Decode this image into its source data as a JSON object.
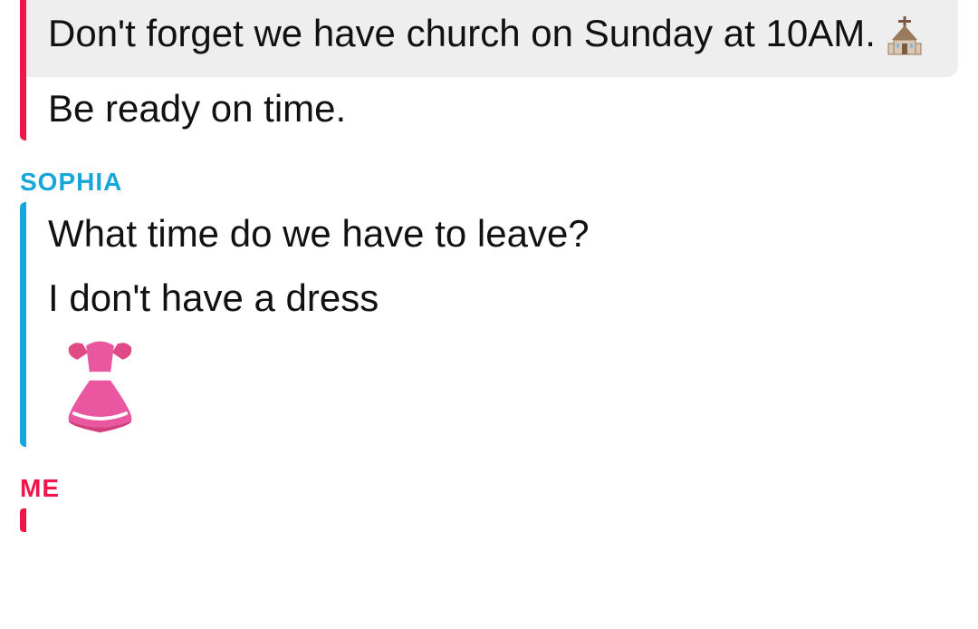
{
  "senders": {
    "me": "ME",
    "sophia": "SOPHIA"
  },
  "messages": {
    "me_block1": {
      "line1": "Don't forget we have church on Sunday at 10AM. ",
      "line2": "Be ready on time."
    },
    "sophia_block": {
      "line1": "What time do we have to leave?",
      "line2": "I don't have a dress"
    },
    "me_block2_label": "ME"
  },
  "icons": {
    "church": "church-icon",
    "dress": "dress-icon"
  }
}
